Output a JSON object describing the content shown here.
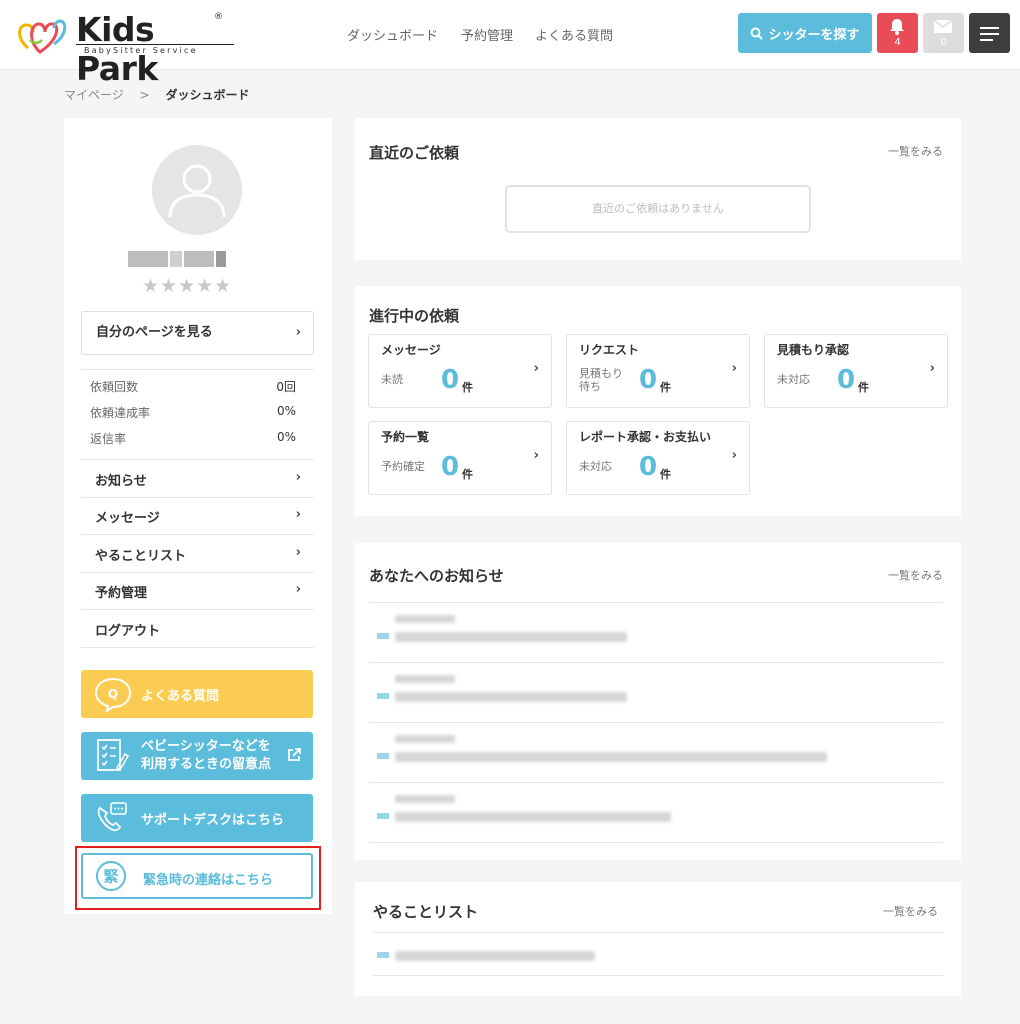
{
  "header": {
    "logo_text": "Kids Park",
    "logo_reg": "®",
    "logo_sub": "BabySitter Service",
    "nav": [
      "ダッシュボード",
      "予約管理",
      "よくある質問"
    ],
    "search_button": "シッターを探す",
    "notifications_count": "4",
    "messages_count": "0"
  },
  "breadcrumb": {
    "home": "マイページ",
    "separator": ">",
    "current": "ダッシュボード"
  },
  "sidebar": {
    "stars": "★★★★★",
    "my_page_button": "自分のページを見る",
    "stats": [
      {
        "label": "依頼回数",
        "value": "0回"
      },
      {
        "label": "依頼達成率",
        "value": "0%"
      },
      {
        "label": "返信率",
        "value": "0%"
      }
    ],
    "menu": [
      "お知らせ",
      "メッセージ",
      "やることリスト",
      "予約管理",
      "ログアウト"
    ],
    "buttons": {
      "faq": "よくある質問",
      "notes_line1": "ベビーシッターなどを",
      "notes_line2": "利用するときの留意点",
      "support": "サポートデスクはこちら",
      "emergency": "緊急時の連絡はこちら",
      "emergency_glyph": "緊"
    },
    "chevron": "›"
  },
  "recent": {
    "title": "直近のご依頼",
    "see_all": "一覧をみる",
    "empty": "直近のご依頼はありません"
  },
  "ongoing": {
    "title": "進行中の依頼",
    "unit": "件",
    "cards": [
      {
        "title": "メッセージ",
        "sub": "未読",
        "count": "0"
      },
      {
        "title": "リクエスト",
        "sub": "見積もり\n待ち",
        "count": "0"
      },
      {
        "title": "見積もり承認",
        "sub": "未対応",
        "count": "0"
      },
      {
        "title": "予約一覧",
        "sub": "予約確定",
        "count": "0"
      },
      {
        "title": "レポート承認・お支払い",
        "sub": "未対応",
        "count": "0"
      }
    ]
  },
  "notices": {
    "title": "あなたへのお知らせ",
    "see_all": "一覧をみる"
  },
  "todo": {
    "title": "やることリスト",
    "see_all": "一覧をみる"
  },
  "colors": {
    "accent": "#5bbcdc",
    "faq": "#fccc52",
    "bell": "#e94b57",
    "menu": "#3e3e3e",
    "highlight": "#e01f1f"
  }
}
